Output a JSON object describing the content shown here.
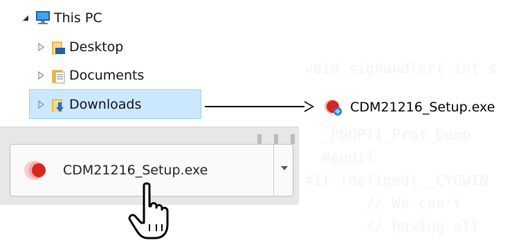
{
  "tree": {
    "root": {
      "label": "This PC",
      "icon": "computer-icon",
      "expanded": true
    },
    "items": [
      {
        "label": "Desktop",
        "icon": "desktop-folder-icon"
      },
      {
        "label": "Documents",
        "icon": "documents-folder-icon"
      },
      {
        "label": "Downloads",
        "icon": "downloads-folder-icon",
        "selected": true
      }
    ]
  },
  "downloaded_file": {
    "label": "CDM21216_Setup.exe",
    "icon": "installer-icon"
  },
  "download_bar": {
    "item_label": "CDM21216_Setup.exe",
    "item_icon": "installer-icon",
    "menu_icon": "chevron-down-icon"
  },
  "background_code": [
    "void sighandler( int s",
    "",
    "  _PGOPTI_Prof_Dump",
    "  #endif",
    "#if !defined(__CYGWIN",
    "       // We can't",
    "       // having all"
  ],
  "colors": {
    "selection": "#cce8ff",
    "selection_border": "#99d1ff",
    "accent_red": "#d7261e"
  }
}
